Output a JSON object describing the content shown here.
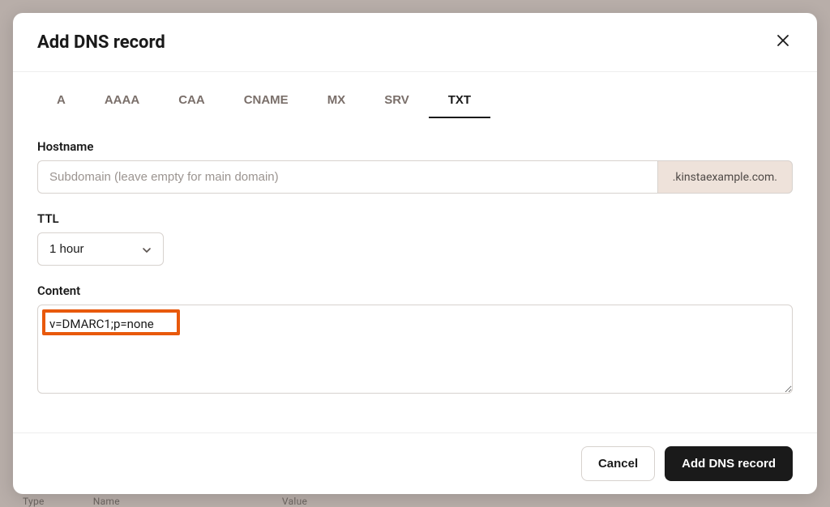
{
  "modal": {
    "title": "Add DNS record"
  },
  "tabs": [
    {
      "label": "A",
      "active": false
    },
    {
      "label": "AAAA",
      "active": false
    },
    {
      "label": "CAA",
      "active": false
    },
    {
      "label": "CNAME",
      "active": false
    },
    {
      "label": "MX",
      "active": false
    },
    {
      "label": "SRV",
      "active": false
    },
    {
      "label": "TXT",
      "active": true
    }
  ],
  "form": {
    "hostname": {
      "label": "Hostname",
      "value": "",
      "placeholder": "Subdomain (leave empty for main domain)",
      "suffix": ".kinstaexample.com."
    },
    "ttl": {
      "label": "TTL",
      "selected": "1 hour"
    },
    "content": {
      "label": "Content",
      "value": "v=DMARC1;p=none"
    }
  },
  "footer": {
    "cancel": "Cancel",
    "submit": "Add DNS record"
  },
  "background": {
    "col1": "Type",
    "col2": "Name",
    "col3": "Value"
  }
}
